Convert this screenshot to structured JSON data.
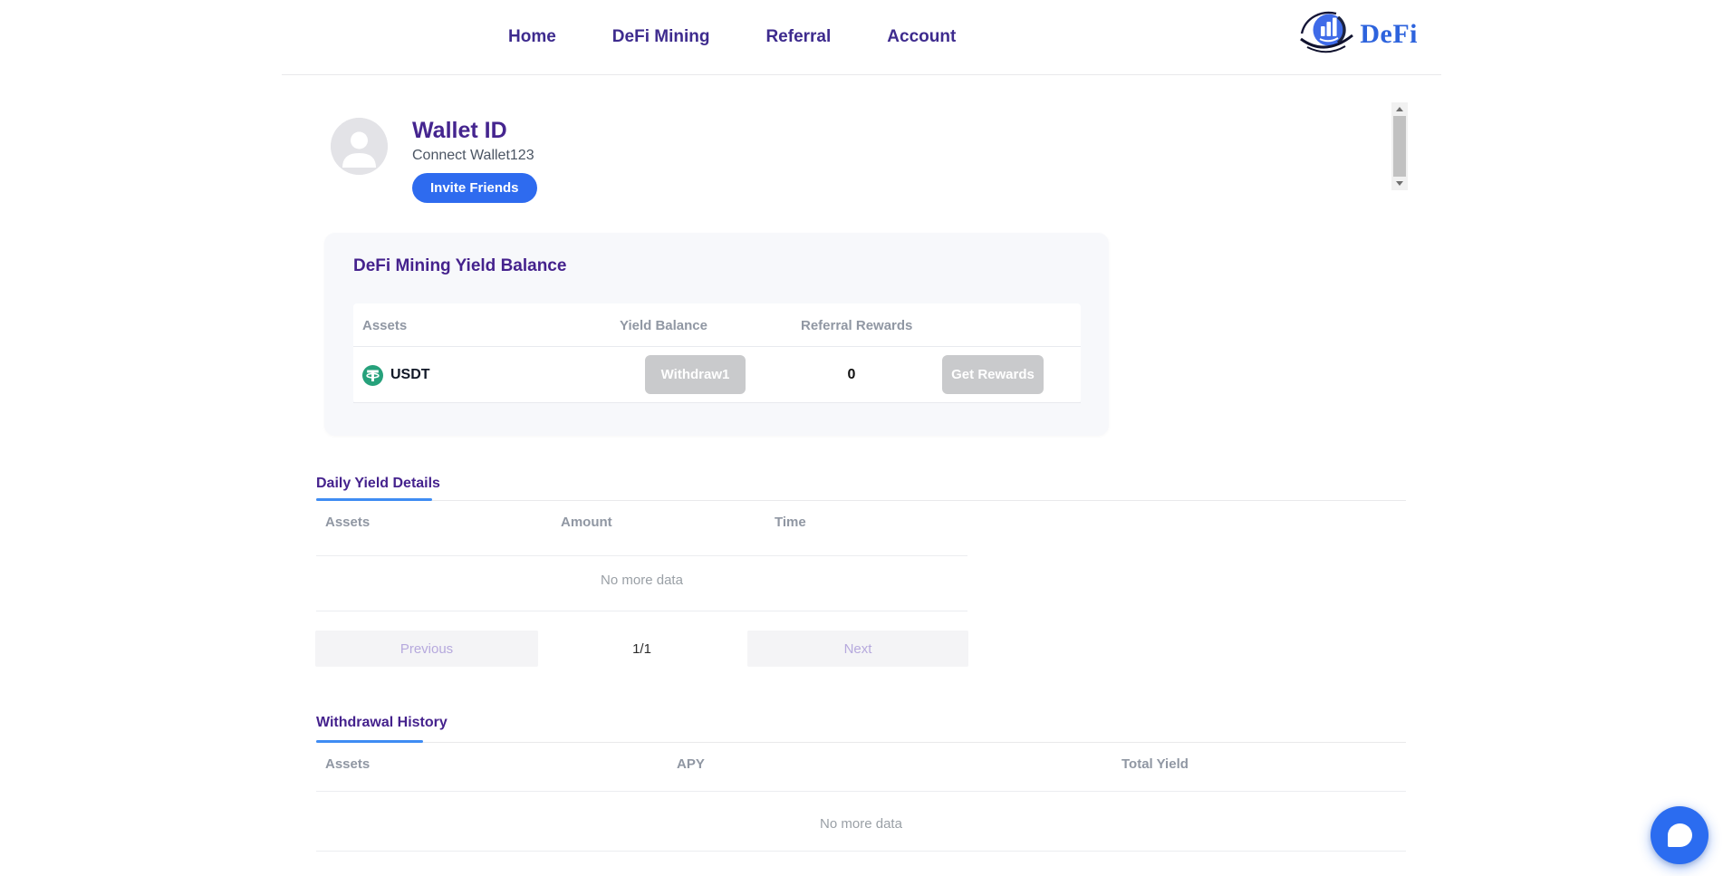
{
  "nav": {
    "items": [
      {
        "label": "Home"
      },
      {
        "label": "DeFi Mining"
      },
      {
        "label": "Referral"
      },
      {
        "label": "Account"
      }
    ],
    "logo_text": "DeFi"
  },
  "profile": {
    "title": "Wallet ID",
    "subtitle": "Connect Wallet123",
    "invite_button": "Invite Friends"
  },
  "yield_card": {
    "title": "DeFi Mining Yield Balance",
    "columns": [
      "Assets",
      "Yield Balance",
      "Referral Rewards"
    ],
    "row": {
      "asset": "USDT",
      "asset_icon": "tether-icon",
      "withdraw_button": "Withdraw1",
      "referral_rewards": "0",
      "rewards_button": "Get Rewards"
    }
  },
  "daily_yield": {
    "title": "Daily Yield Details",
    "columns": [
      "Assets",
      "Amount",
      "Time"
    ],
    "empty_text": "No more data",
    "pagination": {
      "previous": "Previous",
      "page": "1/1",
      "next": "Next"
    }
  },
  "withdrawal_history": {
    "title": "Withdrawal History",
    "columns": [
      "Assets",
      "APY",
      "Total Yield"
    ],
    "empty_text": "No more data"
  },
  "colors": {
    "heading_purple": "#45228d",
    "nav_purple": "#3e2b8e",
    "primary_blue": "#2e6bef",
    "tab_indicator_blue": "#3f8cf3",
    "disabled_button_gray": "#c9cacc",
    "tether_green": "#26a17b",
    "muted_text": "#9aa0a6"
  }
}
